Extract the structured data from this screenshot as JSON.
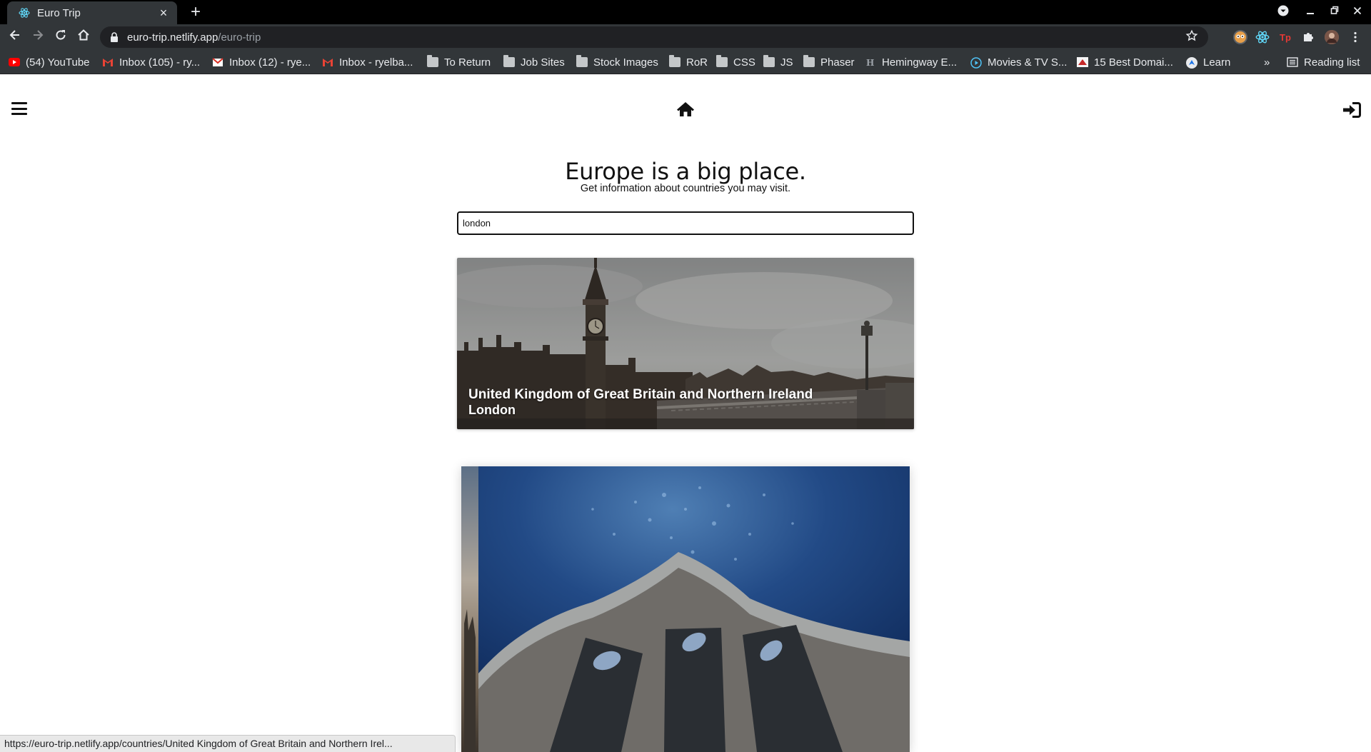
{
  "browser": {
    "tab": {
      "title": "Euro Trip",
      "close_glyph": "×"
    },
    "newtab_glyph": "+",
    "url_host": "euro-trip.netlify.app",
    "url_path": "/euro-trip",
    "bookmarks": [
      {
        "label": "(54) YouTube",
        "icon": "youtube-icon"
      },
      {
        "label": "Inbox (105) - ry...",
        "icon": "gmail-icon"
      },
      {
        "label": "Inbox (12) - rye...",
        "icon": "mail-icon"
      },
      {
        "label": "Inbox - ryelba...",
        "icon": "gmail-icon"
      },
      {
        "label": "To Return",
        "icon": "folder-icon"
      },
      {
        "label": "Job Sites",
        "icon": "folder-icon"
      },
      {
        "label": "Stock Images",
        "icon": "folder-icon"
      },
      {
        "label": "RoR",
        "icon": "folder-icon"
      },
      {
        "label": "CSS",
        "icon": "folder-icon"
      },
      {
        "label": "JS",
        "icon": "folder-icon"
      },
      {
        "label": "Phaser",
        "icon": "folder-icon"
      },
      {
        "label": "Hemingway E...",
        "icon": "hemingway-icon"
      },
      {
        "label": "Movies & TV S...",
        "icon": "play-icon"
      },
      {
        "label": "15 Best Domai...",
        "icon": "site-icon"
      },
      {
        "label": "Learn",
        "icon": "learn-icon"
      }
    ],
    "overflow_glyph": "»",
    "reading_list": "Reading list",
    "status_url": "https://euro-trip.netlify.app/countries/United Kingdom of Great Britain and Northern Irel..."
  },
  "app": {
    "heading": "Europe is a big place.",
    "subheading": "Get information about countries you may visit.",
    "search": {
      "value": "london"
    },
    "results": [
      {
        "country": "United Kingdom of Great Britain and Northern Ireland",
        "capital": "London"
      }
    ]
  },
  "colors": {
    "chrome_dark": "#323639",
    "tabbar": "#000000",
    "omnibox": "#202124",
    "text": "#111111"
  }
}
